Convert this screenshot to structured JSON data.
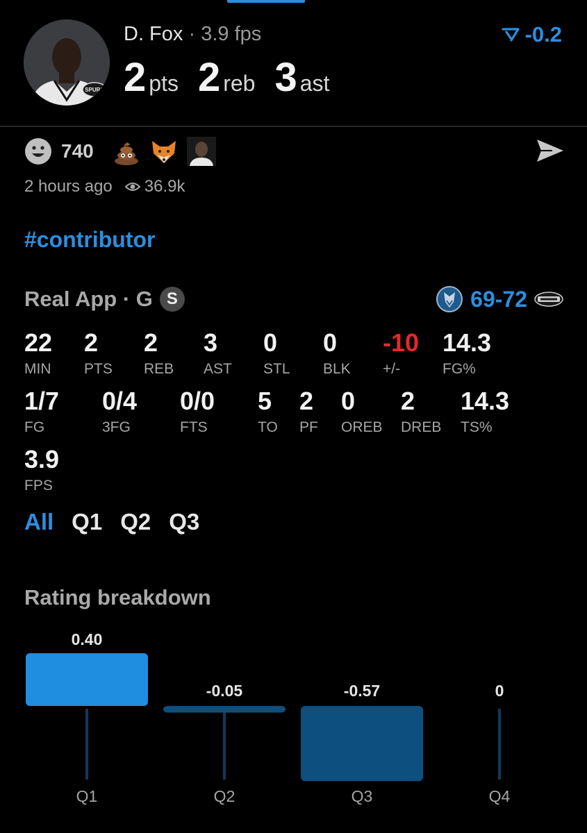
{
  "header": {
    "name": "D. Fox",
    "separator": "·",
    "fps": "3.9 fps",
    "pts": "2",
    "pts_label": "pts",
    "reb": "2",
    "reb_label": "reb",
    "ast": "3",
    "ast_label": "ast",
    "trend": "-0.2",
    "avatar_badge_text": "SPURS"
  },
  "social": {
    "reaction_count": "740",
    "emojis": [
      "smiley-icon",
      "poop-icon",
      "fox-icon",
      "person-face-icon"
    ],
    "time_ago": "2 hours ago",
    "views": "36.9k",
    "hashtag": "#contributor"
  },
  "game": {
    "source": "Real App · G",
    "badge": "S",
    "score_home": "69",
    "score_dash": "-",
    "score_away": "72"
  },
  "stats_row1": [
    {
      "value": "22",
      "label": "MIN"
    },
    {
      "value": "2",
      "label": "PTS"
    },
    {
      "value": "2",
      "label": "REB"
    },
    {
      "value": "3",
      "label": "AST"
    },
    {
      "value": "0",
      "label": "STL"
    },
    {
      "value": "0",
      "label": "BLK"
    },
    {
      "value": "-10",
      "label": "+/-"
    },
    {
      "value": "14.3",
      "label": "FG%"
    }
  ],
  "stats_row2": [
    {
      "value": "1/7",
      "label": "FG"
    },
    {
      "value": "0/4",
      "label": "3FG"
    },
    {
      "value": "0/0",
      "label": "FTS"
    },
    {
      "value": "5",
      "label": "TO"
    },
    {
      "value": "2",
      "label": "PF"
    },
    {
      "value": "0",
      "label": "OREB"
    },
    {
      "value": "2",
      "label": "DREB"
    },
    {
      "value": "14.3",
      "label": "TS%"
    }
  ],
  "stats_row3": [
    {
      "value": "3.9",
      "label": "FPS"
    }
  ],
  "quarter_tabs": [
    "All",
    "Q1",
    "Q2",
    "Q3"
  ],
  "rating_title": "Rating breakdown",
  "colors": {
    "accent": "#2a8fe0",
    "negative": "#e8262b",
    "bar_positive": "#1f8de0",
    "bar_negative": "#0d4f7e"
  },
  "chart_data": {
    "type": "bar",
    "categories": [
      "Q1",
      "Q2",
      "Q3",
      "Q4"
    ],
    "values": [
      0.4,
      -0.05,
      -0.57,
      0
    ],
    "value_labels": [
      "0.40",
      "-0.05",
      "-0.57",
      "0"
    ],
    "title": "Rating breakdown"
  }
}
